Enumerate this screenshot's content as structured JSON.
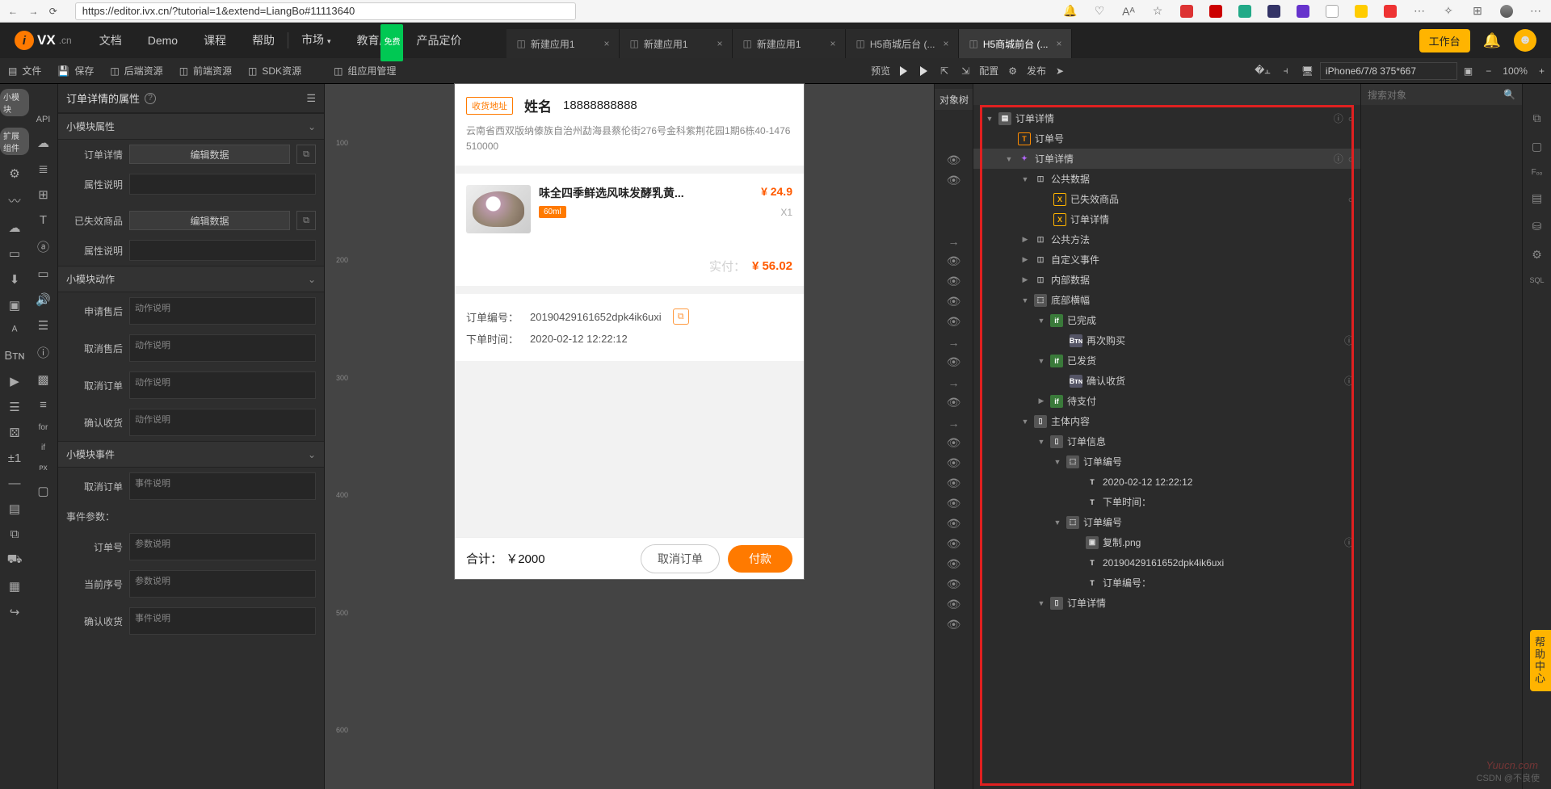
{
  "browser": {
    "url": "https://editor.ivx.cn/?tutorial=1&extend=LiangBo#11113640"
  },
  "menubar": {
    "logo_suffix": ".cn",
    "items": [
      "文档",
      "Demo",
      "课程",
      "帮助"
    ],
    "items2": [
      "市场",
      "教育版",
      "产品定价"
    ],
    "badge_free": "免费",
    "tabs": [
      {
        "label": "新建应用1"
      },
      {
        "label": "新建应用1"
      },
      {
        "label": "新建应用1"
      },
      {
        "label": "H5商城后台 (..."
      },
      {
        "label": "H5商城前台 (...",
        "active": true
      }
    ],
    "workbench": "工作台"
  },
  "toolbar": {
    "groups": [
      "文件",
      "保存",
      "后端资源",
      "前端资源",
      "SDK资源",
      "组应用管理"
    ],
    "preview": "预览",
    "config": "配置",
    "publish": "发布",
    "device": "iPhone6/7/8 375*667",
    "zoom": "100%"
  },
  "leftPills": {
    "p1": "小模块",
    "p2": "扩展组件",
    "api": "API"
  },
  "props": {
    "title": "订单详情的属性",
    "sect_attr": "小模块属性",
    "r_orderDetail": "订单详情",
    "btn_edit": "编辑数据",
    "r_attrDesc": "属性说明",
    "r_expired": "已失效商品",
    "sect_actions": "小模块动作",
    "act_apply": "申请售后",
    "act_cancelAfter": "取消售后",
    "act_cancelOrder": "取消订单",
    "act_confirm": "确认收货",
    "ph_action": "动作说明",
    "sect_events": "小模块事件",
    "ev_cancel": "取消订单",
    "ph_event": "事件说明",
    "ev_params": "事件参数：",
    "p_orderNo": "订单号",
    "p_curNo": "当前序号",
    "p_confirm": "确认收货",
    "ph_param": "参数说明"
  },
  "phone": {
    "addr_tag": "收货地址",
    "name": "姓名",
    "phone": "18888888888",
    "address": "云南省西双版纳傣族自治州勐海县蔡伦街276号金科紫荆花园1期6栋40-1476 510000",
    "prod_title": "味全四季鲜选风味发酵乳黄...",
    "prod_price": "¥ 24.9",
    "vol": "60ml",
    "qty": "X1",
    "pay_label": "实付：",
    "pay_amt": "¥ 56.02",
    "orderNo_label": "订单编号：",
    "orderNo": "20190429161652dpk4ik6uxi",
    "orderTime_label": "下单时间：",
    "orderTime": "2020-02-12 12:22:12",
    "total_label": "合计：",
    "total": "￥2000",
    "btn_cancel": "取消订单",
    "btn_pay": "付款"
  },
  "treeTitle": "对象树",
  "searchPlaceholder": "搜索对象",
  "tree": {
    "n1": "订单详情",
    "n2": "订单号",
    "n3": "订单详情",
    "n4": "公共数据",
    "n5": "已失效商品",
    "n6": "订单详情",
    "n7": "公共方法",
    "n8": "自定义事件",
    "n9": "内部数据",
    "n10": "底部横幅",
    "n11": "已完成",
    "n12": "再次购买",
    "n13": "已发货",
    "n14": "确认收货",
    "n15": "待支付",
    "n16": "主体内容",
    "n17": "订单信息",
    "n18": "订单编号",
    "n19": "2020-02-12 12:22:12",
    "n20": "下单时间：",
    "n21": "订单编号",
    "n22": "复制.png",
    "n23": "20190429161652dpk4ik6uxi",
    "n24": "订单编号：",
    "n25": "订单详情"
  },
  "help": "帮助中心",
  "watermark": "Yuucn.com",
  "csdn": "CSDN @不良使"
}
